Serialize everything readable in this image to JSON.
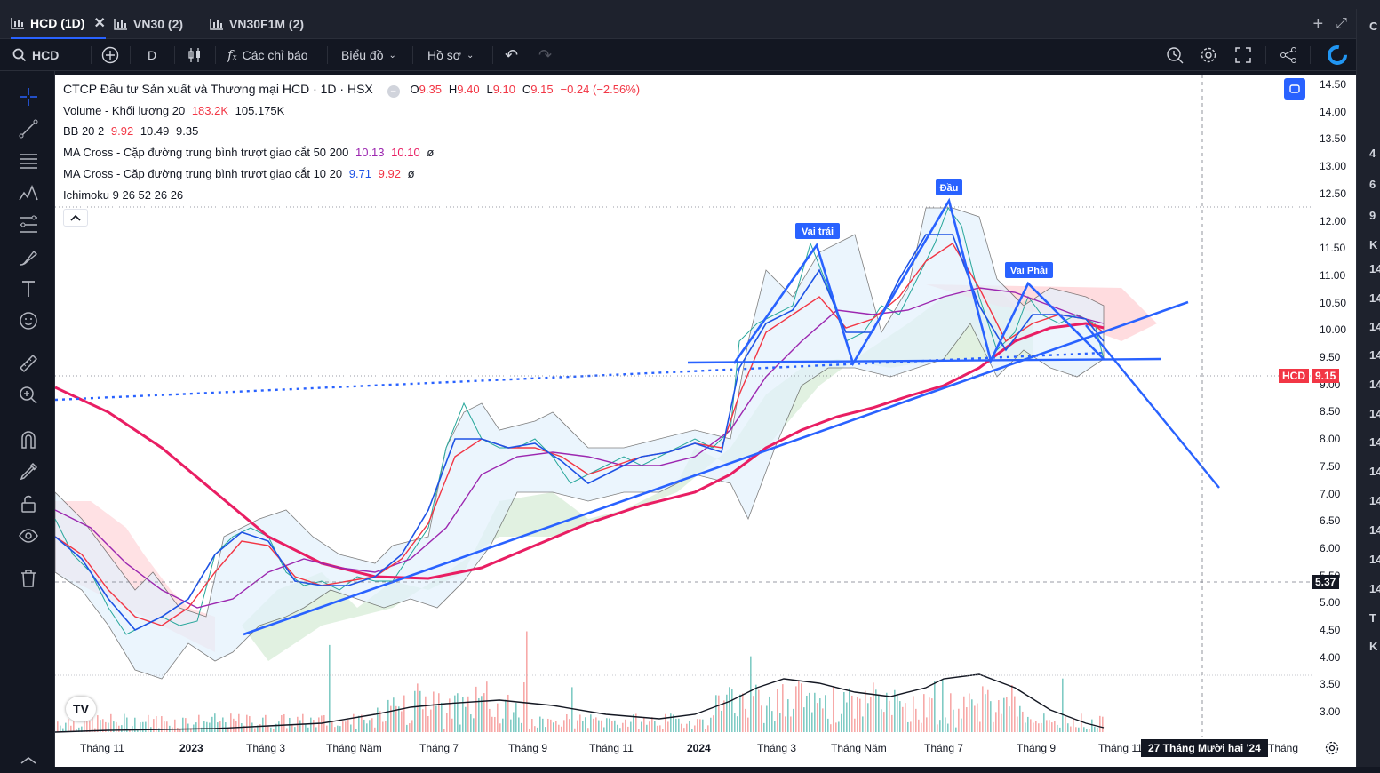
{
  "tabs": [
    {
      "label": "HCD (1D)",
      "active": true
    },
    {
      "label": "VN30 (2)",
      "active": false
    },
    {
      "label": "VN30F1M (2)",
      "active": false
    }
  ],
  "toolbar": {
    "symbol": "HCD",
    "interval": "D",
    "indicators_label": "Các chỉ báo",
    "chart_type_label": "Biểu đồ",
    "profile_label": "Hồ sơ"
  },
  "legend": {
    "title": "CTCP Đầu tư Sản xuất và Thương mại HCD · 1D · HSX",
    "ohlc": {
      "o_label": "O",
      "o": "9.35",
      "h_label": "H",
      "h": "9.40",
      "l_label": "L",
      "l": "9.10",
      "c_label": "C",
      "c": "9.15",
      "change": "−0.24 (−2.56%)"
    },
    "volume": {
      "name": "Volume - Khối lượng 20",
      "v1": "183.2K",
      "v2": "105.175K"
    },
    "bb": {
      "name": "BB 20 2",
      "v1": "9.92",
      "v2": "10.49",
      "v3": "9.35"
    },
    "ma1": {
      "name": "MA Cross - Cặp đường trung bình trượt giao cắt 50 200",
      "v1": "10.13",
      "v2": "10.10",
      "v3": "ø"
    },
    "ma2": {
      "name": "MA Cross - Cặp đường trung bình trượt giao cắt 10 20",
      "v1": "9.71",
      "v2": "9.92",
      "v3": "ø"
    },
    "ichimoku": {
      "name": "Ichimoku 9 26 52 26 26"
    }
  },
  "annotations": {
    "left_shoulder": "Vai trái",
    "head": "Đầu",
    "right_shoulder": "Vai Phải"
  },
  "price_tags": {
    "symbol": "HCD",
    "last": "9.15",
    "crosshair": "5.37"
  },
  "y_ticks": [
    "14.50",
    "14.00",
    "13.50",
    "13.00",
    "12.50",
    "12.00",
    "11.50",
    "11.00",
    "10.50",
    "10.00",
    "9.50",
    "9.00",
    "8.50",
    "8.00",
    "7.50",
    "7.00",
    "6.50",
    "6.00",
    "5.50",
    "5.00",
    "4.50",
    "4.00",
    "3.50",
    "3.00"
  ],
  "x_ticks": [
    "Tháng 11",
    "2023",
    "Tháng 3",
    "Tháng Năm",
    "Tháng 7",
    "Tháng 9",
    "Tháng 11",
    "2024",
    "Tháng 3",
    "Tháng Năm",
    "Tháng 7",
    "Tháng 9",
    "Tháng 11",
    "Tháng"
  ],
  "x_crosshair_label": "27 Tháng Mười hai '24",
  "logo_text": "TV",
  "right_panel": [
    "C",
    "4",
    "6",
    "9",
    "K",
    "14",
    "14",
    "14",
    "14",
    "14",
    "14",
    "14",
    "14",
    "14",
    "14",
    "14",
    "14",
    "T",
    "K"
  ],
  "colors": {
    "accent": "#2962ff",
    "down": "#f23645",
    "ma_red": "#e91e63",
    "ma_purple": "#9c27b0",
    "trend_blue": "#2962ff",
    "bb_fill": "#e3f2fd",
    "ichimoku_green": "#a5d6a7",
    "ichimoku_red": "#ffcdd2"
  },
  "chart_data": {
    "type": "line",
    "title": "CTCP Đầu tư Sản xuất và Thương mại HCD · 1D · HSX",
    "x": [
      "Tháng 11",
      "2023",
      "Tháng 3",
      "Tháng Năm",
      "Tháng 7",
      "Tháng 9",
      "Tháng 11",
      "2024",
      "Tháng 3",
      "Tháng Năm",
      "Tháng 7",
      "Tháng 9",
      "Tháng 11"
    ],
    "series": [
      {
        "name": "HCD",
        "values": [
          5.2,
          4.6,
          5.8,
          5.3,
          7.9,
          7.7,
          7.6,
          8.0,
          11.2,
          10.0,
          12.2,
          10.3,
          9.15
        ]
      },
      {
        "name": "MA 200",
        "values": [
          8.8,
          6.9,
          5.8,
          5.5,
          5.7,
          6.4,
          7.0,
          7.3,
          8.5,
          9.2,
          9.4,
          10.0,
          10.1
        ]
      }
    ],
    "ylim": [
      3.0,
      14.5
    ]
  }
}
